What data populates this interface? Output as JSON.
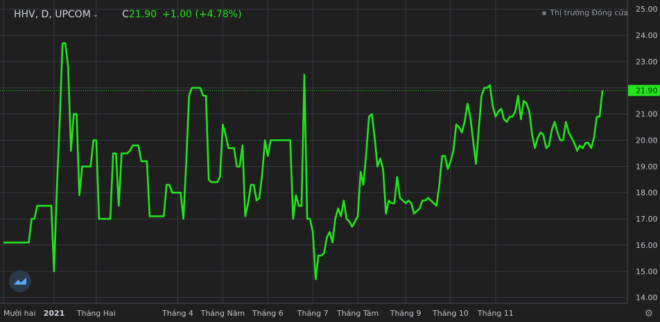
{
  "header": {
    "symbol": "HHV, D, UPCOM",
    "close_label": "C",
    "close_value": "21.90",
    "change": "+1.00 (+4.78%)",
    "market_status": "Thị trường Đóng cửa"
  },
  "colors": {
    "background": "#1f1f1f",
    "grid": "#363a45",
    "line": "#22e61c",
    "last_price_bg": "#22e61c",
    "axis_text": "#c2c5cc"
  },
  "icons": {
    "logo": "tradingview-logo-icon",
    "settings": "gear-icon",
    "dropdown": "chevron-down-icon"
  },
  "chart_data": {
    "type": "line",
    "title": "",
    "xlabel": "",
    "ylabel": "",
    "ylim": [
      13.78,
      25.35
    ],
    "y_ticks": [
      "14.00",
      "15.00",
      "16.00",
      "17.00",
      "18.00",
      "19.00",
      "20.00",
      "21.00",
      "22.00",
      "23.00",
      "24.00",
      "25.00"
    ],
    "x_ticks": [
      {
        "label": "Mười hai",
        "i": 0,
        "bold": false
      },
      {
        "label": "2021",
        "i": 18,
        "bold": true
      },
      {
        "label": "Tháng Hai",
        "i": 33,
        "bold": false
      },
      {
        "label": "Tháng 4",
        "i": 62,
        "bold": false
      },
      {
        "label": "Tháng Năm",
        "i": 78,
        "bold": false
      },
      {
        "label": "Tháng 6",
        "i": 94,
        "bold": false
      },
      {
        "label": "Tháng 7",
        "i": 110,
        "bold": false
      },
      {
        "label": "Tháng Tám",
        "i": 126,
        "bold": false
      },
      {
        "label": "Tháng 9",
        "i": 143,
        "bold": false
      },
      {
        "label": "Tháng 10",
        "i": 159,
        "bold": false
      },
      {
        "label": "Tháng 11",
        "i": 175,
        "bold": false
      }
    ],
    "last_price": "21.90",
    "grid": true,
    "series": [
      {
        "values": [
          16.1,
          16.1,
          16.1,
          16.1,
          16.1,
          16.1,
          16.1,
          16.1,
          16.1,
          16.1,
          17.0,
          17.0,
          17.5,
          17.5,
          17.5,
          17.5,
          17.5,
          17.5,
          15.0,
          18.2,
          20.7,
          23.7,
          23.7,
          22.8,
          19.6,
          21.0,
          21.0,
          17.9,
          19.0,
          19.0,
          19.0,
          19.0,
          20.0,
          20.0,
          17.0,
          17.0,
          17.0,
          17.0,
          17.0,
          19.5,
          19.5,
          17.5,
          19.5,
          19.5,
          19.5,
          19.6,
          19.8,
          19.8,
          19.8,
          19.2,
          19.2,
          19.2,
          17.1,
          17.1,
          17.1,
          17.1,
          17.1,
          17.1,
          18.3,
          18.3,
          18.0,
          18.0,
          18.0,
          18.0,
          17.0,
          19.2,
          21.7,
          22.0,
          22.0,
          22.0,
          22.0,
          21.7,
          21.7,
          18.5,
          18.4,
          18.4,
          18.4,
          18.6,
          20.6,
          20.2,
          19.7,
          19.7,
          19.7,
          19.0,
          19.0,
          19.8,
          17.1,
          17.6,
          18.3,
          18.3,
          17.7,
          17.8,
          18.7,
          20.0,
          19.4,
          20.0,
          20.0,
          20.0,
          20.0,
          20.0,
          20.0,
          20.0,
          20.0,
          17.0,
          17.9,
          17.5,
          17.5,
          22.5,
          17.0,
          17.0,
          16.5,
          14.7,
          15.6,
          15.6,
          15.7,
          16.3,
          16.5,
          16.1,
          17.0,
          17.4,
          17.1,
          17.7,
          17.0,
          16.9,
          16.7,
          16.9,
          17.1,
          18.8,
          18.3,
          19.5,
          20.9,
          21.0,
          20.1,
          19.0,
          19.3,
          18.9,
          17.2,
          17.7,
          17.6,
          17.6,
          18.6,
          17.8,
          17.7,
          17.6,
          17.7,
          17.6,
          17.2,
          17.3,
          17.4,
          17.7,
          17.7,
          17.8,
          17.7,
          17.6,
          17.5,
          18.3,
          19.4,
          19.4,
          18.9,
          19.2,
          19.6,
          20.6,
          20.5,
          20.3,
          20.7,
          21.4,
          20.9,
          20.0,
          19.1,
          20.4,
          21.7,
          22.0,
          22.0,
          22.1,
          21.3,
          20.9,
          21.1,
          21.2,
          20.8,
          20.7,
          20.9,
          20.9,
          21.1,
          21.7,
          20.8,
          21.5,
          21.4,
          21.1,
          20.2,
          19.7,
          20.1,
          20.3,
          20.2,
          19.7,
          19.8,
          20.4,
          20.7,
          20.3,
          20.0,
          20.0,
          20.7,
          20.3,
          20.1,
          19.9,
          19.6,
          19.8,
          19.7,
          19.9,
          19.9,
          19.7,
          20.1,
          20.9,
          20.9,
          21.9
        ]
      }
    ]
  }
}
